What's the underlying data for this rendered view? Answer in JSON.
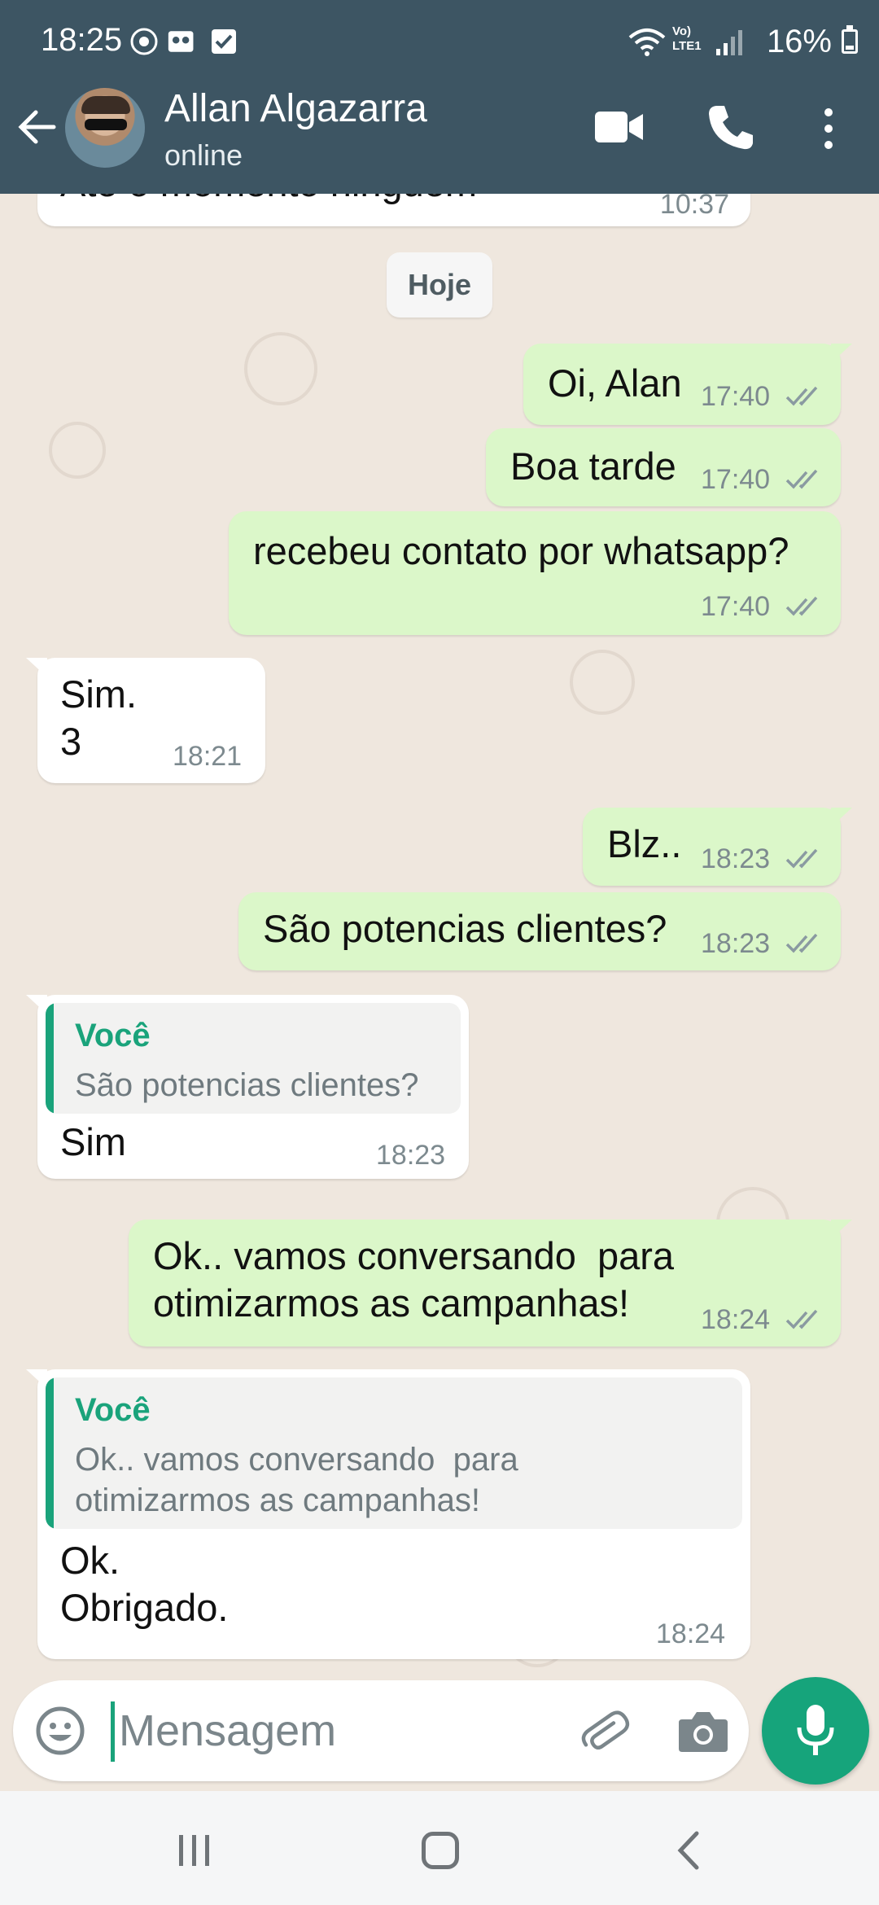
{
  "status_bar": {
    "time": "18:25",
    "network_label": "Vo) LTE1",
    "battery": "16%"
  },
  "header": {
    "contact_name": "Allan Algazarra",
    "contact_status": "online"
  },
  "chat": {
    "partial_message": {
      "text": "Até o momento ninguém",
      "time": "10:37"
    },
    "date_chip": "Hoje",
    "messages": [
      {
        "dir": "out",
        "text": "Oi, Alan",
        "time": "17:40"
      },
      {
        "dir": "out",
        "text": "Boa tarde",
        "time": "17:40"
      },
      {
        "dir": "out",
        "text": "recebeu contato por whatsapp?",
        "time": "17:40"
      },
      {
        "dir": "in",
        "text": "Sim.\n3",
        "time": "18:21"
      },
      {
        "dir": "out",
        "text": "Blz..",
        "time": "18:23"
      },
      {
        "dir": "out",
        "text": "São potencias clientes?",
        "time": "18:23"
      },
      {
        "dir": "in",
        "quote_author": "Você",
        "quote_text": "São potencias clientes?",
        "text": "Sim",
        "time": "18:23"
      },
      {
        "dir": "out",
        "text": "Ok.. vamos conversando  para\notimizarmos as campanhas!",
        "time": "18:24"
      },
      {
        "dir": "in",
        "quote_author": "Você",
        "quote_text": "Ok.. vamos conversando  para\notimizarmos as campanhas!",
        "text": "Ok.\nObrigado.",
        "time": "18:24"
      }
    ]
  },
  "composer": {
    "placeholder": "Mensagem"
  },
  "colors": {
    "header": "#3d5563",
    "outgoing_bubble": "#dbf7c9",
    "incoming_bubble": "#ffffff",
    "accent": "#1aa37b",
    "read_ticks": "#8a9aa1"
  },
  "icons": [
    "back-arrow-icon",
    "video-call-icon",
    "phone-icon",
    "more-vert-icon",
    "emoji-icon",
    "attach-icon",
    "camera-icon",
    "mic-icon",
    "double-check-icon"
  ]
}
